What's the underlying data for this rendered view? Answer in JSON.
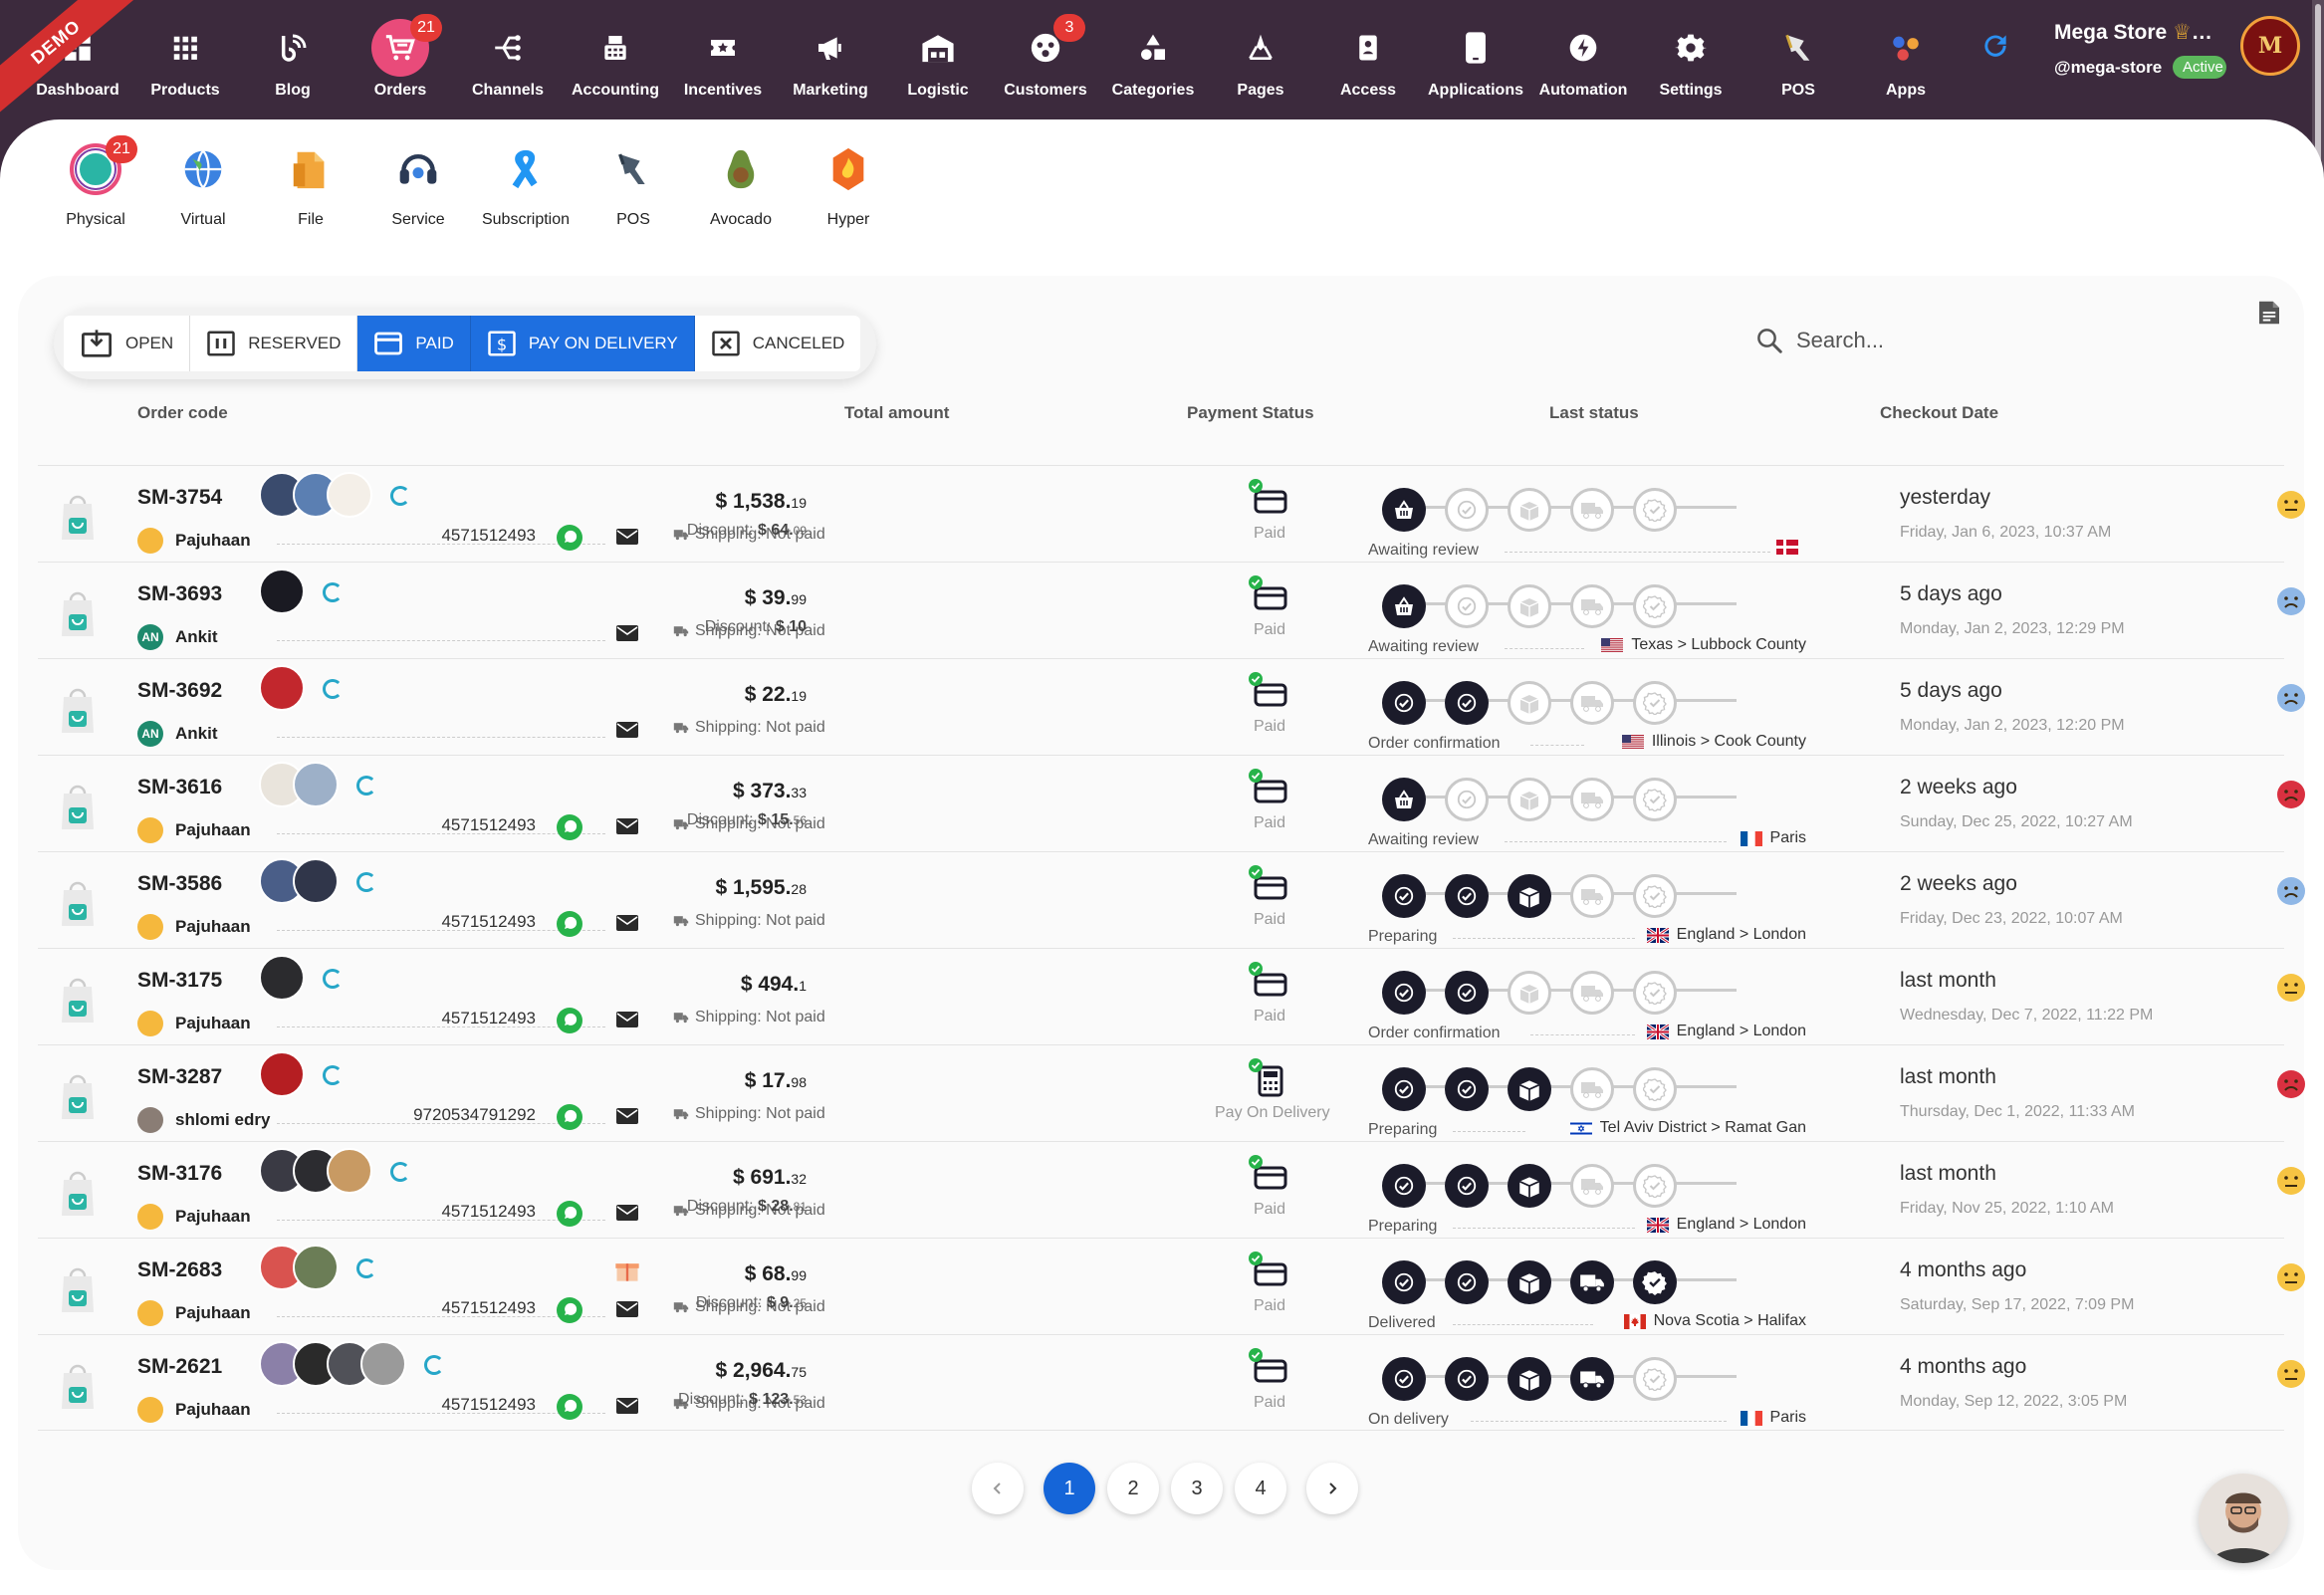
{
  "nav": {
    "demo": "DEMO",
    "items": [
      {
        "label": "Dashboard",
        "icon": "dashboard-icon"
      },
      {
        "label": "Products",
        "icon": "grid-icon"
      },
      {
        "label": "Blog",
        "icon": "blog-icon"
      },
      {
        "label": "Orders",
        "icon": "cart-icon",
        "badge": "21",
        "active": true
      },
      {
        "label": "Channels",
        "icon": "channels-icon"
      },
      {
        "label": "Accounting",
        "icon": "calculator-icon"
      },
      {
        "label": "Incentives",
        "icon": "ticket-icon"
      },
      {
        "label": "Marketing",
        "icon": "megaphone-icon"
      },
      {
        "label": "Logistic",
        "icon": "warehouse-icon"
      },
      {
        "label": "Customers",
        "icon": "users-icon",
        "badge": "3"
      },
      {
        "label": "Categories",
        "icon": "shapes-icon"
      },
      {
        "label": "Pages",
        "icon": "pen-tool-icon"
      },
      {
        "label": "Access",
        "icon": "id-card-icon"
      },
      {
        "label": "Applications",
        "icon": "phone-icon"
      },
      {
        "label": "Automation",
        "icon": "bolt-icon"
      },
      {
        "label": "Settings",
        "icon": "gear-icon"
      },
      {
        "label": "POS",
        "icon": "scanner-icon"
      },
      {
        "label": "Apps",
        "icon": "apps-icon"
      }
    ]
  },
  "account": {
    "name": "Mega Store",
    "handle": "@mega-store",
    "status": "Active",
    "avatar_letter": "M"
  },
  "subnav": {
    "items": [
      {
        "label": "Physical",
        "badge": "21"
      },
      {
        "label": "Virtual"
      },
      {
        "label": "File"
      },
      {
        "label": "Service"
      },
      {
        "label": "Subscription"
      },
      {
        "label": "POS"
      },
      {
        "label": "Avocado"
      },
      {
        "label": "Hyper"
      }
    ]
  },
  "filters": [
    {
      "label": "OPEN",
      "active": false
    },
    {
      "label": "RESERVED",
      "active": false
    },
    {
      "label": "PAID",
      "active": true
    },
    {
      "label": "PAY ON DELIVERY",
      "active": true
    },
    {
      "label": "CANCELED",
      "active": false
    }
  ],
  "search": {
    "placeholder": "Search..."
  },
  "table": {
    "headers": {
      "code": "Order code",
      "amount": "Total amount",
      "payment": "Payment Status",
      "last": "Last status",
      "checkout": "Checkout Date"
    },
    "shipping_text": "Shipping: Not paid",
    "rows": [
      {
        "code": "SM-3754",
        "customer": "Pajuhaan",
        "avatar": "y",
        "phone": "4571512493",
        "wa": true,
        "amount_int": "$ 1,538.",
        "amount_dec": "19",
        "discount_int": "$ 64.",
        "discount_dec": "09",
        "payment": "Paid",
        "status": "Awaiting review",
        "steps": 1,
        "location": "",
        "flag": "dk",
        "when": "yesterday",
        "date": "Friday, Jan 6, 2023, 10:37 AM",
        "emoji": "neutral",
        "thumbs": [
          "#3a4b6d",
          "#5b7fb2",
          "#f4efe8"
        ]
      },
      {
        "code": "SM-3693",
        "customer": "Ankit",
        "avatar": "g",
        "initials": "AN",
        "phone": "",
        "wa": false,
        "amount_int": "$ 39.",
        "amount_dec": "99",
        "discount_int": "$ 10",
        "discount_dec": "",
        "payment": "Paid",
        "status": "Awaiting review",
        "steps": 1,
        "location": "Texas > Lubbock County",
        "flag": "us",
        "when": "5 days ago",
        "date": "Monday, Jan 2, 2023, 12:29 PM",
        "emoji": "sad",
        "thumbs": [
          "#1a1a22"
        ]
      },
      {
        "code": "SM-3692",
        "customer": "Ankit",
        "avatar": "g",
        "initials": "AN",
        "phone": "",
        "wa": false,
        "amount_int": "$ 22.",
        "amount_dec": "19",
        "discount_int": "",
        "discount_dec": "",
        "payment": "Paid",
        "status": "Order confirmation",
        "steps": 2,
        "location": "Illinois > Cook County",
        "flag": "us",
        "when": "5 days ago",
        "date": "Monday, Jan 2, 2023, 12:20 PM",
        "emoji": "sad",
        "thumbs": [
          "#c2272d"
        ]
      },
      {
        "code": "SM-3616",
        "customer": "Pajuhaan",
        "avatar": "y",
        "phone": "4571512493",
        "wa": true,
        "amount_int": "$ 373.",
        "amount_dec": "33",
        "discount_int": "$ 15.",
        "discount_dec": "56",
        "payment": "Paid",
        "status": "Awaiting review",
        "steps": 1,
        "location": "Paris",
        "flag": "fr",
        "when": "2 weeks ago",
        "date": "Sunday, Dec 25, 2022, 10:27 AM",
        "emoji": "angry",
        "thumbs": [
          "#e9e4dc",
          "#9db0c8"
        ]
      },
      {
        "code": "SM-3586",
        "customer": "Pajuhaan",
        "avatar": "y",
        "phone": "4571512493",
        "wa": true,
        "amount_int": "$ 1,595.",
        "amount_dec": "28",
        "discount_int": "",
        "discount_dec": "",
        "payment": "Paid",
        "status": "Preparing",
        "steps": 3,
        "location": "England > London",
        "flag": "gb",
        "when": "2 weeks ago",
        "date": "Friday, Dec 23, 2022, 10:07 AM",
        "emoji": "sad",
        "thumbs": [
          "#4a5e88",
          "#30364a"
        ]
      },
      {
        "code": "SM-3175",
        "customer": "Pajuhaan",
        "avatar": "y",
        "phone": "4571512493",
        "wa": true,
        "amount_int": "$ 494.",
        "amount_dec": "1",
        "discount_int": "",
        "discount_dec": "",
        "payment": "Paid",
        "status": "Order confirmation",
        "steps": 2,
        "location": "England > London",
        "flag": "gb",
        "when": "last month",
        "date": "Wednesday, Dec 7, 2022, 11:22 PM",
        "emoji": "neutral",
        "thumbs": [
          "#2b2b2e"
        ]
      },
      {
        "code": "SM-3287",
        "customer": "shlomi edry",
        "avatar": "p",
        "phone": "9720534791292",
        "wa": true,
        "amount_int": "$ 17.",
        "amount_dec": "98",
        "discount_int": "",
        "discount_dec": "",
        "payment": "Pay On Delivery",
        "status": "Preparing",
        "steps": 3,
        "location": "Tel Aviv District > Ramat Gan",
        "flag": "il",
        "when": "last month",
        "date": "Thursday, Dec 1, 2022, 11:33 AM",
        "emoji": "angry",
        "thumbs": [
          "#b51e22"
        ]
      },
      {
        "code": "SM-3176",
        "customer": "Pajuhaan",
        "avatar": "y",
        "phone": "4571512493",
        "wa": true,
        "amount_int": "$ 691.",
        "amount_dec": "32",
        "discount_int": "$ 28.",
        "discount_dec": "81",
        "payment": "Paid",
        "status": "Preparing",
        "steps": 3,
        "location": "England > London",
        "flag": "gb",
        "when": "last month",
        "date": "Friday, Nov 25, 2022, 1:10 AM",
        "emoji": "neutral",
        "thumbs": [
          "#3a3a44",
          "#2c2c30",
          "#c89a63"
        ]
      },
      {
        "code": "SM-2683",
        "customer": "Pajuhaan",
        "avatar": "y",
        "phone": "4571512493",
        "wa": true,
        "amount_int": "$ 68.",
        "amount_dec": "99",
        "discount_int": "$ 9.",
        "discount_dec": "25",
        "payment": "Paid",
        "status": "Delivered",
        "steps": 5,
        "location": "Nova Scotia > Halifax",
        "flag": "ca",
        "when": "4 months ago",
        "date": "Saturday, Sep 17, 2022, 7:09 PM",
        "emoji": "neutral",
        "thumbs": [
          "#d9534f",
          "#6b7d56"
        ]
      },
      {
        "code": "SM-2621",
        "customer": "Pajuhaan",
        "avatar": "y",
        "phone": "4571512493",
        "wa": true,
        "amount_int": "$ 2,964.",
        "amount_dec": "75",
        "discount_int": "$ 123.",
        "discount_dec": "53",
        "payment": "Paid",
        "status": "On delivery",
        "steps": 4,
        "location": "Paris",
        "flag": "fr",
        "when": "4 months ago",
        "date": "Monday, Sep 12, 2022, 3:05 PM",
        "emoji": "neutral",
        "thumbs": [
          "#8b80a8",
          "#2a2a2a",
          "#505158",
          "#9a9a9a"
        ]
      }
    ]
  },
  "pagination": {
    "pages": [
      "1",
      "2",
      "3",
      "4"
    ],
    "current": "1"
  },
  "colors": {
    "nav_bg": "#3c2a3d",
    "accent": "#1e6fe0",
    "active_nav": "#e94b7a",
    "badge": "#e53935"
  }
}
